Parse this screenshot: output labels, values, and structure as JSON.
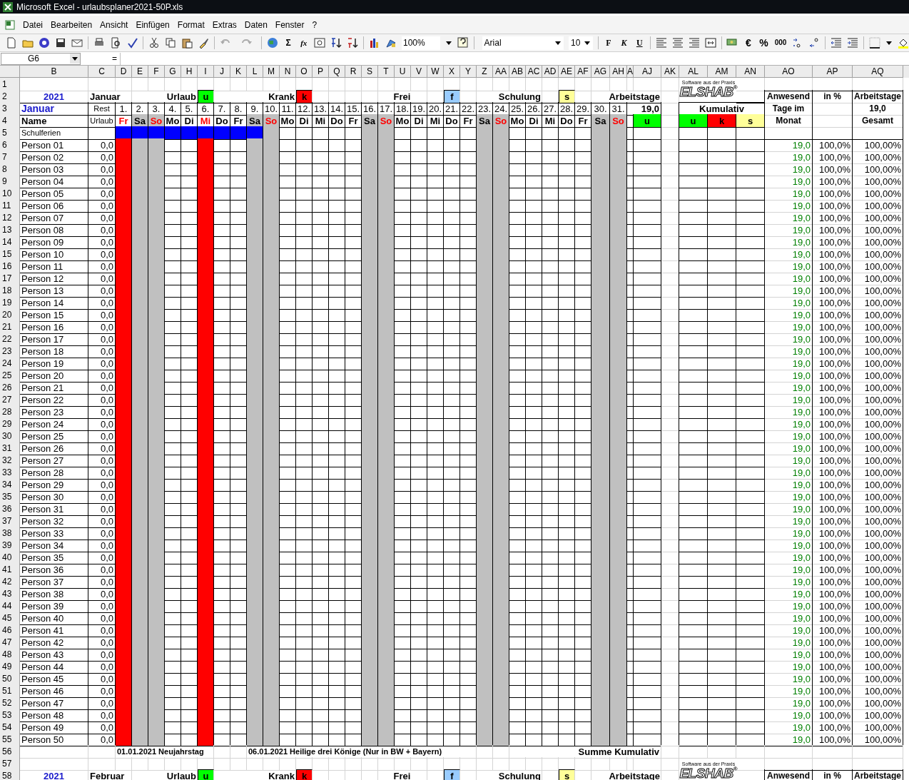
{
  "window": {
    "title": "Microsoft Excel - urlaubsplaner2021-50P.xls"
  },
  "menu": [
    "Datei",
    "Bearbeiten",
    "Ansicht",
    "Einfügen",
    "Format",
    "Extras",
    "Daten",
    "Fenster",
    "?"
  ],
  "toolbar": {
    "sum": "Σ",
    "function": "fx",
    "zoom": "100%",
    "font": "Arial",
    "size": "10",
    "format_buttons": [
      "F",
      "K",
      "U"
    ],
    "number_buttons": [
      "€",
      "%",
      "000"
    ]
  },
  "formula_bar": {
    "name_box": "G6",
    "label": "="
  },
  "columns": [
    "B",
    "C",
    "D",
    "E",
    "F",
    "G",
    "H",
    "I",
    "J",
    "K",
    "L",
    "M",
    "N",
    "O",
    "P",
    "Q",
    "R",
    "S",
    "T",
    "U",
    "V",
    "W",
    "X",
    "Y",
    "Z",
    "AA",
    "AB",
    "AC",
    "AD",
    "AE",
    "AF",
    "AG",
    "AH",
    "A",
    "AJ",
    "AK",
    "AL",
    "AM",
    "AN",
    "AO",
    "AP",
    "AQ"
  ],
  "row_numbers": [
    "1",
    "2",
    "3",
    "4",
    "5",
    "6",
    "7",
    "8",
    "9",
    "10",
    "11",
    "12",
    "13",
    "14",
    "15",
    "16",
    "17",
    "18",
    "19",
    "20",
    "21",
    "22",
    "23",
    "24",
    "25",
    "26",
    "27",
    "28",
    "29",
    "30",
    "31",
    "32",
    "33",
    "34",
    "35",
    "36",
    "37",
    "38",
    "39",
    "40",
    "41",
    "42",
    "43",
    "44",
    "45",
    "46",
    "47",
    "48",
    "49",
    "50",
    "51",
    "52",
    "53",
    "54",
    "55",
    "56",
    "57",
    "58"
  ],
  "month_block": {
    "logo": {
      "name": "ELSHAB",
      "slogan": "Software aus der Praxis",
      "mark": "®"
    },
    "year": "2021",
    "month": "Januar",
    "legend": [
      {
        "label": "Urlaub",
        "code": "u",
        "color": "#00ff00"
      },
      {
        "label": "Krank",
        "code": "k",
        "color": "#ff0000"
      },
      {
        "label": "Frei",
        "code": "f",
        "color": "#99ccff"
      },
      {
        "label": "Schulung",
        "code": "s",
        "color": "#ffff99"
      }
    ],
    "workdays_label": "Arbeitstage",
    "month_name": "Januar",
    "rest_label": "Rest",
    "vacation_label": "Urlaub",
    "name_label": "Name",
    "school_label": "Schulferien",
    "workdays": "19,0",
    "workdays_code": {
      "code": "u",
      "color": "#00ff00"
    },
    "cumulative": {
      "title": "Kumulativ",
      "codes": [
        {
          "code": "u",
          "color": "#00ff00"
        },
        {
          "code": "k",
          "color": "#ff0000"
        },
        {
          "code": "s",
          "color": "#ffff99"
        }
      ]
    },
    "right_headers": [
      [
        "Anwesend",
        "Tage im",
        "Monat"
      ],
      [
        "in %"
      ],
      [
        "Arbeitstage",
        "19,0",
        "Gesamt"
      ]
    ],
    "days": [
      {
        "day": "1.",
        "weekday": "Fr",
        "kind": "holiday",
        "school_holiday": true
      },
      {
        "day": "2.",
        "weekday": "Sa",
        "kind": "saturday",
        "school_holiday": true
      },
      {
        "day": "3.",
        "weekday": "So",
        "kind": "sunday",
        "school_holiday": true
      },
      {
        "day": "4.",
        "weekday": "Mo",
        "kind": "workday",
        "school_holiday": true
      },
      {
        "day": "5.",
        "weekday": "Di",
        "kind": "workday",
        "school_holiday": true
      },
      {
        "day": "6.",
        "weekday": "Mi",
        "kind": "holiday",
        "school_holiday": true
      },
      {
        "day": "7.",
        "weekday": "Do",
        "kind": "workday",
        "school_holiday": true
      },
      {
        "day": "8.",
        "weekday": "Fr",
        "kind": "workday",
        "school_holiday": true
      },
      {
        "day": "9.",
        "weekday": "Sa",
        "kind": "saturday",
        "school_holiday": true
      },
      {
        "day": "10.",
        "weekday": "So",
        "kind": "sunday",
        "school_holiday": false
      },
      {
        "day": "11.",
        "weekday": "Mo",
        "kind": "workday",
        "school_holiday": false
      },
      {
        "day": "12.",
        "weekday": "Di",
        "kind": "workday",
        "school_holiday": false
      },
      {
        "day": "13.",
        "weekday": "Mi",
        "kind": "workday",
        "school_holiday": false
      },
      {
        "day": "14.",
        "weekday": "Do",
        "kind": "workday",
        "school_holiday": false
      },
      {
        "day": "15.",
        "weekday": "Fr",
        "kind": "workday",
        "school_holiday": false
      },
      {
        "day": "16.",
        "weekday": "Sa",
        "kind": "saturday",
        "school_holiday": false
      },
      {
        "day": "17.",
        "weekday": "So",
        "kind": "sunday",
        "school_holiday": false
      },
      {
        "day": "18.",
        "weekday": "Mo",
        "kind": "workday",
        "school_holiday": false
      },
      {
        "day": "19.",
        "weekday": "Di",
        "kind": "workday",
        "school_holiday": false
      },
      {
        "day": "20.",
        "weekday": "Mi",
        "kind": "workday",
        "school_holiday": false
      },
      {
        "day": "21.",
        "weekday": "Do",
        "kind": "workday",
        "school_holiday": false
      },
      {
        "day": "22.",
        "weekday": "Fr",
        "kind": "workday",
        "school_holiday": false
      },
      {
        "day": "23.",
        "weekday": "Sa",
        "kind": "saturday",
        "school_holiday": false
      },
      {
        "day": "24.",
        "weekday": "So",
        "kind": "sunday",
        "school_holiday": false
      },
      {
        "day": "25.",
        "weekday": "Mo",
        "kind": "workday",
        "school_holiday": false
      },
      {
        "day": "26.",
        "weekday": "Di",
        "kind": "workday",
        "school_holiday": false
      },
      {
        "day": "27.",
        "weekday": "Mi",
        "kind": "workday",
        "school_holiday": false
      },
      {
        "day": "28.",
        "weekday": "Do",
        "kind": "workday",
        "school_holiday": false
      },
      {
        "day": "29.",
        "weekday": "Fr",
        "kind": "workday",
        "school_holiday": false
      },
      {
        "day": "30.",
        "weekday": "Sa",
        "kind": "saturday",
        "school_holiday": false
      },
      {
        "day": "31.",
        "weekday": "So",
        "kind": "sunday",
        "school_holiday": false
      }
    ],
    "persons": [
      {
        "name": "Person 01",
        "rest": "0,0",
        "present": "19,0",
        "percent": "100,0%",
        "total": "100,00%"
      },
      {
        "name": "Person 02",
        "rest": "0,0",
        "present": "19,0",
        "percent": "100,0%",
        "total": "100,00%"
      },
      {
        "name": "Person 03",
        "rest": "0,0",
        "present": "19,0",
        "percent": "100,0%",
        "total": "100,00%"
      },
      {
        "name": "Person 04",
        "rest": "0,0",
        "present": "19,0",
        "percent": "100,0%",
        "total": "100,00%"
      },
      {
        "name": "Person 05",
        "rest": "0,0",
        "present": "19,0",
        "percent": "100,0%",
        "total": "100,00%"
      },
      {
        "name": "Person 06",
        "rest": "0,0",
        "present": "19,0",
        "percent": "100,0%",
        "total": "100,00%"
      },
      {
        "name": "Person 07",
        "rest": "0,0",
        "present": "19,0",
        "percent": "100,0%",
        "total": "100,00%"
      },
      {
        "name": "Person 08",
        "rest": "0,0",
        "present": "19,0",
        "percent": "100,0%",
        "total": "100,00%"
      },
      {
        "name": "Person 09",
        "rest": "0,0",
        "present": "19,0",
        "percent": "100,0%",
        "total": "100,00%"
      },
      {
        "name": "Person 10",
        "rest": "0,0",
        "present": "19,0",
        "percent": "100,0%",
        "total": "100,00%"
      },
      {
        "name": "Person 11",
        "rest": "0,0",
        "present": "19,0",
        "percent": "100,0%",
        "total": "100,00%"
      },
      {
        "name": "Person 12",
        "rest": "0,0",
        "present": "19,0",
        "percent": "100,0%",
        "total": "100,00%"
      },
      {
        "name": "Person 13",
        "rest": "0,0",
        "present": "19,0",
        "percent": "100,0%",
        "total": "100,00%"
      },
      {
        "name": "Person 14",
        "rest": "0,0",
        "present": "19,0",
        "percent": "100,0%",
        "total": "100,00%"
      },
      {
        "name": "Person 15",
        "rest": "0,0",
        "present": "19,0",
        "percent": "100,0%",
        "total": "100,00%"
      },
      {
        "name": "Person 16",
        "rest": "0,0",
        "present": "19,0",
        "percent": "100,0%",
        "total": "100,00%"
      },
      {
        "name": "Person 17",
        "rest": "0,0",
        "present": "19,0",
        "percent": "100,0%",
        "total": "100,00%"
      },
      {
        "name": "Person 18",
        "rest": "0,0",
        "present": "19,0",
        "percent": "100,0%",
        "total": "100,00%"
      },
      {
        "name": "Person 19",
        "rest": "0,0",
        "present": "19,0",
        "percent": "100,0%",
        "total": "100,00%"
      },
      {
        "name": "Person 20",
        "rest": "0,0",
        "present": "19,0",
        "percent": "100,0%",
        "total": "100,00%"
      },
      {
        "name": "Person 21",
        "rest": "0,0",
        "present": "19,0",
        "percent": "100,0%",
        "total": "100,00%"
      },
      {
        "name": "Person 22",
        "rest": "0,0",
        "present": "19,0",
        "percent": "100,0%",
        "total": "100,00%"
      },
      {
        "name": "Person 23",
        "rest": "0,0",
        "present": "19,0",
        "percent": "100,0%",
        "total": "100,00%"
      },
      {
        "name": "Person 24",
        "rest": "0,0",
        "present": "19,0",
        "percent": "100,0%",
        "total": "100,00%"
      },
      {
        "name": "Person 25",
        "rest": "0,0",
        "present": "19,0",
        "percent": "100,0%",
        "total": "100,00%"
      },
      {
        "name": "Person 26",
        "rest": "0,0",
        "present": "19,0",
        "percent": "100,0%",
        "total": "100,00%"
      },
      {
        "name": "Person 27",
        "rest": "0,0",
        "present": "19,0",
        "percent": "100,0%",
        "total": "100,00%"
      },
      {
        "name": "Person 28",
        "rest": "0,0",
        "present": "19,0",
        "percent": "100,0%",
        "total": "100,00%"
      },
      {
        "name": "Person 29",
        "rest": "0,0",
        "present": "19,0",
        "percent": "100,0%",
        "total": "100,00%"
      },
      {
        "name": "Person 30",
        "rest": "0,0",
        "present": "19,0",
        "percent": "100,0%",
        "total": "100,00%"
      },
      {
        "name": "Person 31",
        "rest": "0,0",
        "present": "19,0",
        "percent": "100,0%",
        "total": "100,00%"
      },
      {
        "name": "Person 32",
        "rest": "0,0",
        "present": "19,0",
        "percent": "100,0%",
        "total": "100,00%"
      },
      {
        "name": "Person 33",
        "rest": "0,0",
        "present": "19,0",
        "percent": "100,0%",
        "total": "100,00%"
      },
      {
        "name": "Person 34",
        "rest": "0,0",
        "present": "19,0",
        "percent": "100,0%",
        "total": "100,00%"
      },
      {
        "name": "Person 35",
        "rest": "0,0",
        "present": "19,0",
        "percent": "100,0%",
        "total": "100,00%"
      },
      {
        "name": "Person 36",
        "rest": "0,0",
        "present": "19,0",
        "percent": "100,0%",
        "total": "100,00%"
      },
      {
        "name": "Person 37",
        "rest": "0,0",
        "present": "19,0",
        "percent": "100,0%",
        "total": "100,00%"
      },
      {
        "name": "Person 38",
        "rest": "0,0",
        "present": "19,0",
        "percent": "100,0%",
        "total": "100,00%"
      },
      {
        "name": "Person 39",
        "rest": "0,0",
        "present": "19,0",
        "percent": "100,0%",
        "total": "100,00%"
      },
      {
        "name": "Person 40",
        "rest": "0,0",
        "present": "19,0",
        "percent": "100,0%",
        "total": "100,00%"
      },
      {
        "name": "Person 41",
        "rest": "0,0",
        "present": "19,0",
        "percent": "100,0%",
        "total": "100,00%"
      },
      {
        "name": "Person 42",
        "rest": "0,0",
        "present": "19,0",
        "percent": "100,0%",
        "total": "100,00%"
      },
      {
        "name": "Person 43",
        "rest": "0,0",
        "present": "19,0",
        "percent": "100,0%",
        "total": "100,00%"
      },
      {
        "name": "Person 44",
        "rest": "0,0",
        "present": "19,0",
        "percent": "100,0%",
        "total": "100,00%"
      },
      {
        "name": "Person 45",
        "rest": "0,0",
        "present": "19,0",
        "percent": "100,0%",
        "total": "100,00%"
      },
      {
        "name": "Person 46",
        "rest": "0,0",
        "present": "19,0",
        "percent": "100,0%",
        "total": "100,00%"
      },
      {
        "name": "Person 47",
        "rest": "0,0",
        "present": "19,0",
        "percent": "100,0%",
        "total": "100,00%"
      },
      {
        "name": "Person 48",
        "rest": "0,0",
        "present": "19,0",
        "percent": "100,0%",
        "total": "100,00%"
      },
      {
        "name": "Person 49",
        "rest": "0,0",
        "present": "19,0",
        "percent": "100,0%",
        "total": "100,00%"
      },
      {
        "name": "Person 50",
        "rest": "0,0",
        "present": "19,0",
        "percent": "100,0%",
        "total": "100,00%"
      }
    ],
    "notes": [
      "01.01.2021 Neujahrstag",
      "06.01.2021 Heilige drei Könige (Nur in BW + Bayern)"
    ],
    "summary_label": "Summe Kumulativ"
  },
  "next_block": {
    "logo": {
      "name": "ELSHAB",
      "slogan": "Software aus der Praxis",
      "mark": "®"
    },
    "year": "2021",
    "month": "Februar",
    "legend": [
      {
        "label": "Urlaub",
        "code": "u",
        "color": "#00ff00"
      },
      {
        "label": "Krank",
        "code": "k",
        "color": "#ff0000"
      },
      {
        "label": "Frei",
        "code": "f",
        "color": "#99ccff"
      },
      {
        "label": "Schulung",
        "code": "s",
        "color": "#ffff99"
      }
    ],
    "workdays_label": "Arbeitstage",
    "right_headers": [
      "Anwesend",
      "in %",
      "Arbeitstage"
    ]
  }
}
